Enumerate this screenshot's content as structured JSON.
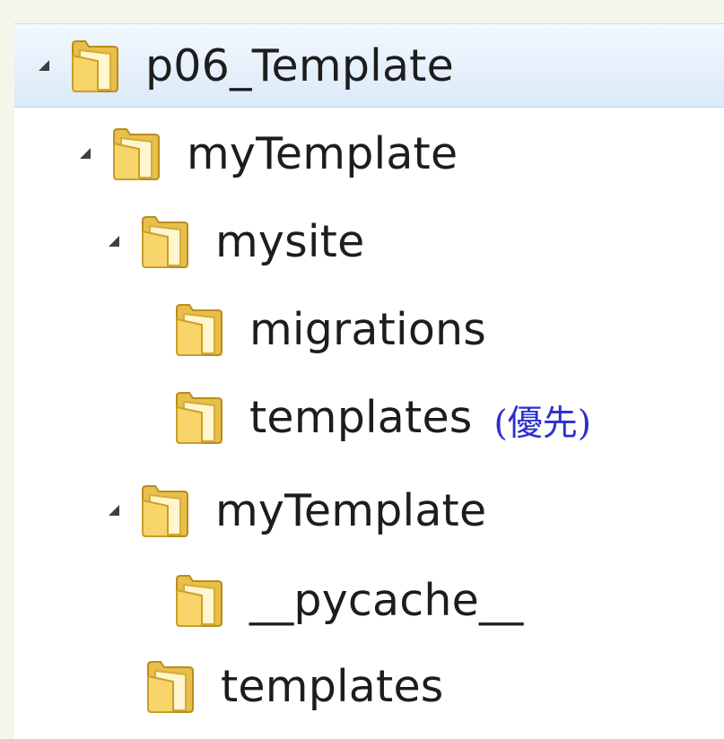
{
  "tree": {
    "items": [
      {
        "label": "p06_Template",
        "expanded": true,
        "selected": true,
        "icon": "folder-icon"
      },
      {
        "label": "myTemplate",
        "expanded": true,
        "icon": "folder-icon"
      },
      {
        "label": "mysite",
        "expanded": true,
        "icon": "folder-icon"
      },
      {
        "label": "migrations",
        "icon": "folder-icon"
      },
      {
        "label": "templates",
        "note": "(優先)",
        "icon": "folder-icon"
      },
      {
        "label": "myTemplate",
        "expanded": true,
        "icon": "folder-icon"
      },
      {
        "label": "__pycache__",
        "icon": "folder-icon"
      },
      {
        "label": "templates",
        "icon": "folder-icon"
      }
    ]
  },
  "colors": {
    "selection": "#e6f0fb",
    "note": "#2b2fd0",
    "folder": "#f3cf6a",
    "background": "#ffffff"
  }
}
